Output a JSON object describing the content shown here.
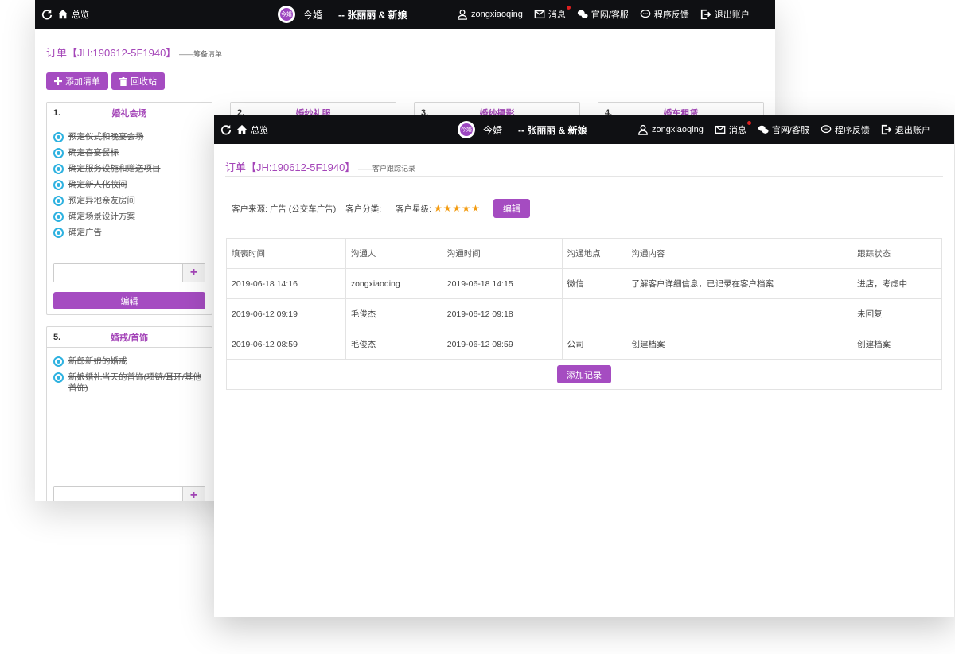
{
  "topbar": {
    "home_label": "总览",
    "brand_name": "今婚",
    "brand_logo_text": "今婚",
    "couple": "-- 张丽丽 & 新娘",
    "username": "zongxiaoqing",
    "messages_label": "消息",
    "service_label": "官网/客服",
    "feedback_label": "程序反馈",
    "logout_label": "退出账户"
  },
  "back": {
    "order_title": "订单【JH:190612-5F1940】",
    "subtitle": "——筹备清单",
    "add_list_label": "添加清单",
    "recycle_label": "回收站",
    "cards": [
      {
        "num": "1.",
        "title": "婚礼会场",
        "tasks": [
          "预定仪式和晚宴会场",
          "确定喜宴餐标",
          "确定服务设施和赠送项目",
          "确定新人化妆间",
          "预定异地亲友房间",
          "确定场景设计方案",
          "确定广告"
        ],
        "edit_label": "编辑"
      },
      {
        "num": "2.",
        "title": "婚纱礼服"
      },
      {
        "num": "3.",
        "title": "婚纱摄影"
      },
      {
        "num": "4.",
        "title": "婚车租赁"
      },
      {
        "num": "5.",
        "title": "婚戒/首饰",
        "tasks": [
          "新郎新娘的婚戒",
          "新娘婚礼当天的首饰(项链/耳环/其他首饰)"
        ]
      }
    ]
  },
  "front": {
    "order_title": "订单【JH:190612-5F1940】",
    "subtitle": "——客户跟踪记录",
    "source_label": "客户来源:",
    "source_value": "广告 (公交车广告)",
    "category_label": "客户分类:",
    "rating_label": "客户星级:",
    "stars": "★★★★★",
    "edit_label": "编辑",
    "columns": [
      "填表时间",
      "沟通人",
      "沟通时间",
      "沟通地点",
      "沟通内容",
      "跟踪状态"
    ],
    "rows": [
      [
        "2019-06-18 14:16",
        "zongxiaoqing",
        "2019-06-18 14:15",
        "微信",
        "了解客户详细信息，已记录在客户档案",
        "进店，考虑中"
      ],
      [
        "2019-06-12 09:19",
        "毛俊杰",
        "2019-06-12 09:18",
        "",
        "",
        "未回复"
      ],
      [
        "2019-06-12 08:59",
        "毛俊杰",
        "2019-06-12 08:59",
        "公司",
        "创建档案",
        "创建档案"
      ]
    ],
    "add_record_label": "添加记录"
  },
  "colors": {
    "accent": "#a54cc1",
    "topbar": "#0f1013",
    "radio": "#2fb2e0",
    "star": "#f39c12",
    "notify_dot": "#e02020"
  },
  "icons": [
    "refresh-icon",
    "home-icon",
    "user-icon",
    "mail-icon",
    "chat-icon",
    "comment-icon",
    "logout-icon",
    "plus-icon",
    "trash-icon"
  ]
}
